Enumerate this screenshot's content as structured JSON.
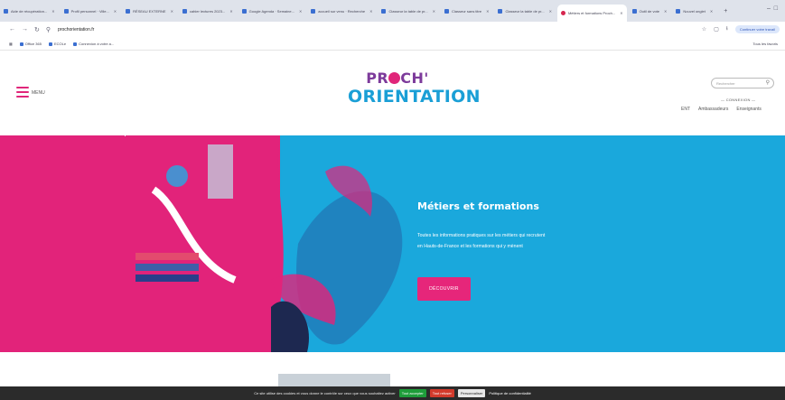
{
  "browser": {
    "tabs": [
      {
        "label": "Aide de récupération..."
      },
      {
        "label": "Profil personnel · Ville..."
      },
      {
        "label": "RÉSEAU EXTERNE"
      },
      {
        "label": "cahier lectures 2023..."
      },
      {
        "label": "Google Agenda · Semaine..."
      },
      {
        "label": "accueil sur venu · Recherche"
      },
      {
        "label": "Classeur la table de pr..."
      },
      {
        "label": "Classeur sans titre"
      },
      {
        "label": "Classeur la table de pr..."
      },
      {
        "label": "Métiers et formations Proch..."
      },
      {
        "label": "Outil de vote"
      },
      {
        "label": "Nouvel onglet"
      }
    ],
    "url": "prochorientation.fr",
    "profile_label": "Continuer votre travail",
    "bookmarks": [
      {
        "label": "Office 365"
      },
      {
        "label": "ECOLe"
      },
      {
        "label": "Connexion à votre a..."
      }
    ],
    "all_bookmarks_label": "Tous les favoris"
  },
  "site": {
    "menu_label": "MENU",
    "logo_top_left": "PR",
    "logo_top_right": "CH'",
    "logo_bottom": "ORIENTATION",
    "search_placeholder": "Rechercher",
    "connexion": "— CONNEXION —",
    "links": [
      "ENT",
      "Ambassadeurs",
      "Enseignants"
    ]
  },
  "hero": {
    "title": "Métiers et formations",
    "description": "Toutes les informations pratiques sur les métiers qui recrutent en Hauts-de-France et les formations qui y mènent",
    "button": "DÉCOUVRIR"
  },
  "cookie": {
    "text": "Ce site utilise des cookies et vous donne le contrôle sur ceux que vous souhaitez activer",
    "accept": "Tout accepter",
    "refuse": "Tout refuser",
    "customize": "Personnaliser",
    "policy": "Politique de confidentialité"
  },
  "colors": {
    "pink": "#e2237a",
    "blue": "#1aa8dc",
    "purple": "#7d3b9b"
  }
}
